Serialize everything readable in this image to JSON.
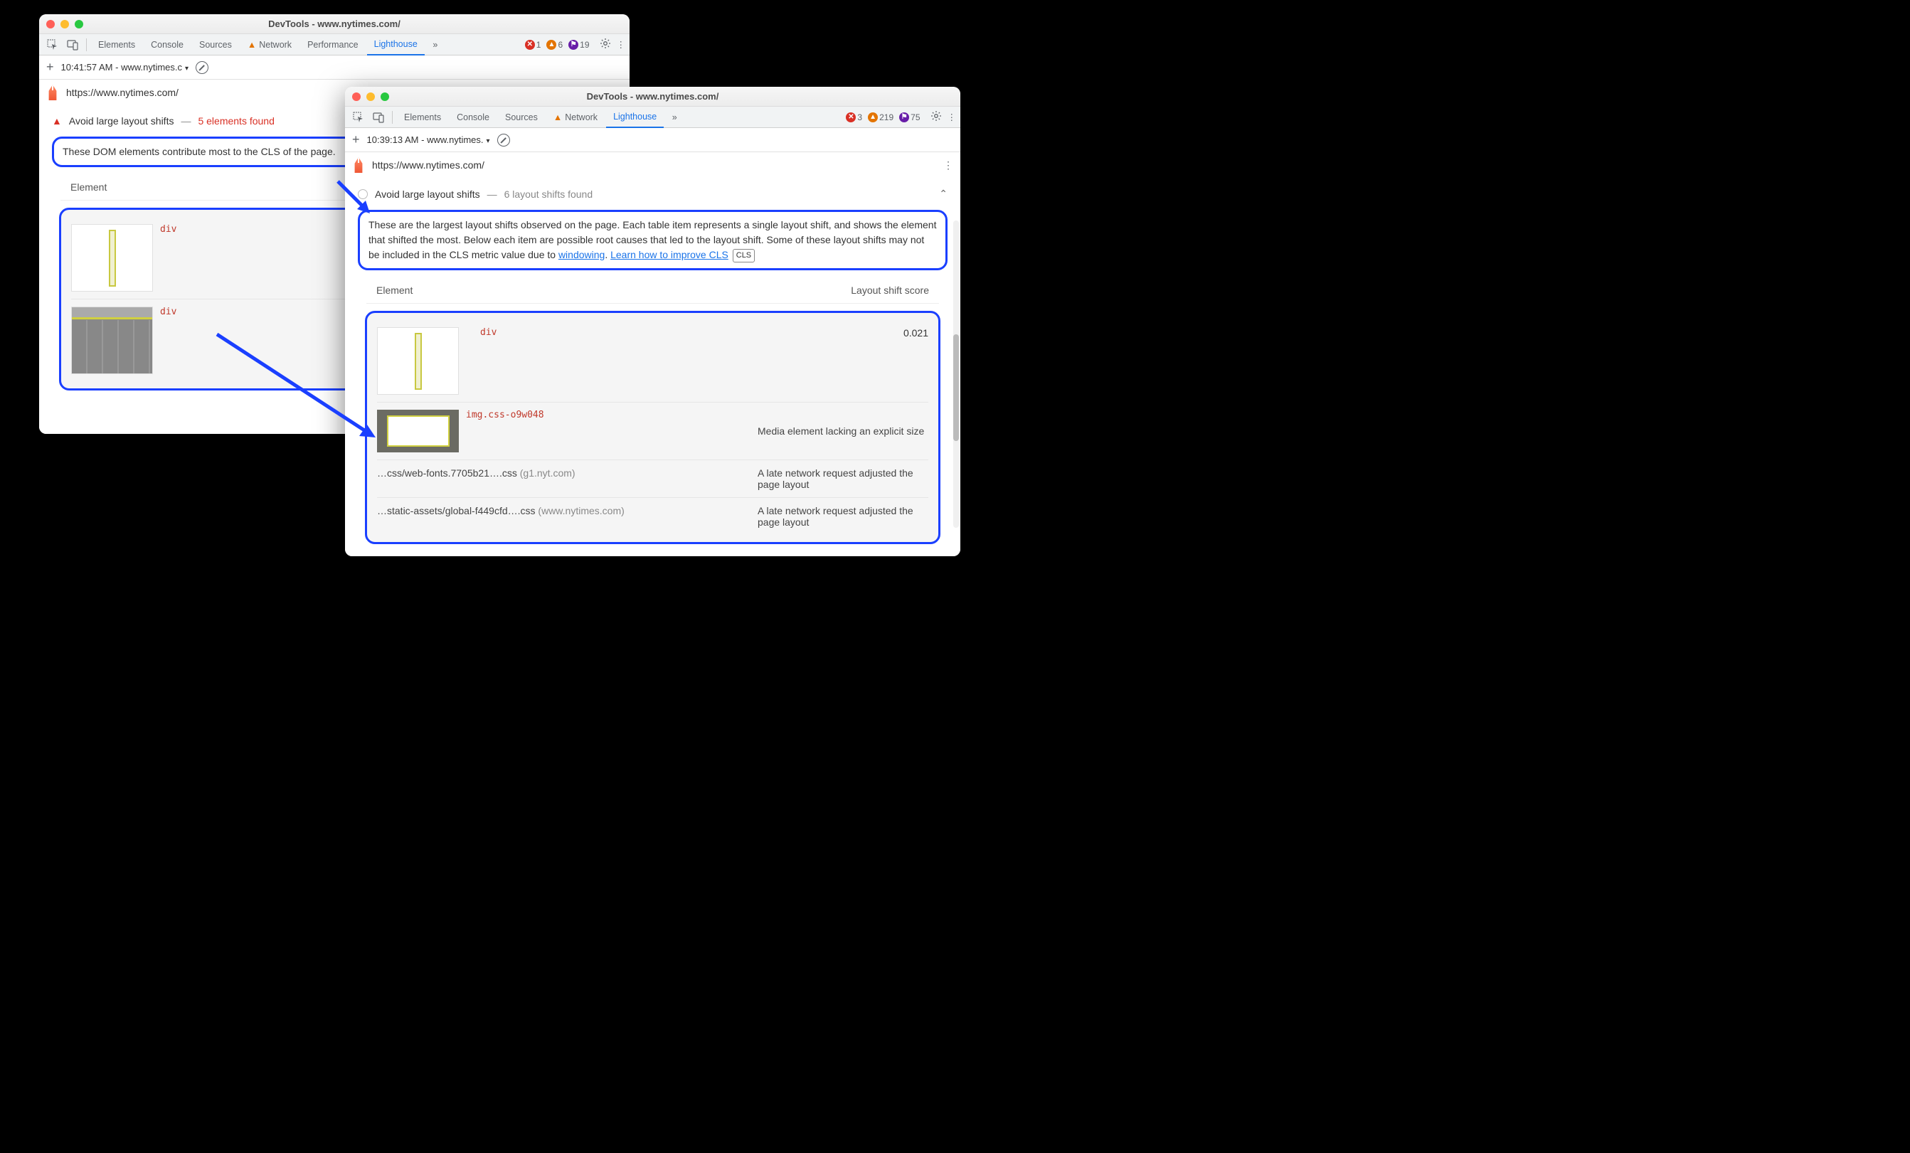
{
  "window1": {
    "title": "DevTools - www.nytimes.com/",
    "tabs": [
      "Elements",
      "Console",
      "Sources",
      "Network",
      "Performance",
      "Lighthouse"
    ],
    "activeTab": "Lighthouse",
    "errors": 1,
    "warnings": 6,
    "issues": 19,
    "runLabel": "10:41:57 AM - www.nytimes.c",
    "url": "https://www.nytimes.com/",
    "auditTitle": "Avoid large layout shifts",
    "auditFound": "5 elements found",
    "desc": "These DOM elements contribute most to the CLS of the page.",
    "colElement": "Element",
    "rows": [
      {
        "code": "div"
      },
      {
        "code": "div"
      }
    ]
  },
  "window2": {
    "title": "DevTools - www.nytimes.com/",
    "tabs": [
      "Elements",
      "Console",
      "Sources",
      "Network",
      "Lighthouse"
    ],
    "activeTab": "Lighthouse",
    "errors": 3,
    "warnings": 219,
    "issues": 75,
    "runLabel": "10:39:13 AM - www.nytimes.",
    "url": "https://www.nytimes.com/",
    "auditTitle": "Avoid large layout shifts",
    "auditFound": "6 layout shifts found",
    "desc1": "These are the largest layout shifts observed on the page. Each table item represents a single layout shift, and shows the element that shifted the most. Below each item are possible root causes that led to the layout shift. Some of these layout shifts may not be included in the CLS metric value due to ",
    "descLink1": "windowing",
    "descMid": ". ",
    "descLink2": "Learn how to improve CLS",
    "descChip": "CLS",
    "colElement": "Element",
    "colScore": "Layout shift score",
    "row1": {
      "code": "div",
      "score": "0.021"
    },
    "row2": {
      "code": "img.css-o9w048",
      "cause": "Media element lacking an explicit size"
    },
    "row3": {
      "path": "…css/web-fonts.7705b21….css",
      "origin": "(g1.nyt.com)",
      "cause": "A late network request adjusted the page layout"
    },
    "row4": {
      "path": "…static-assets/global-f449cfd….css",
      "origin": "(www.nytimes.com)",
      "cause": "A late network request adjusted the page layout"
    }
  }
}
